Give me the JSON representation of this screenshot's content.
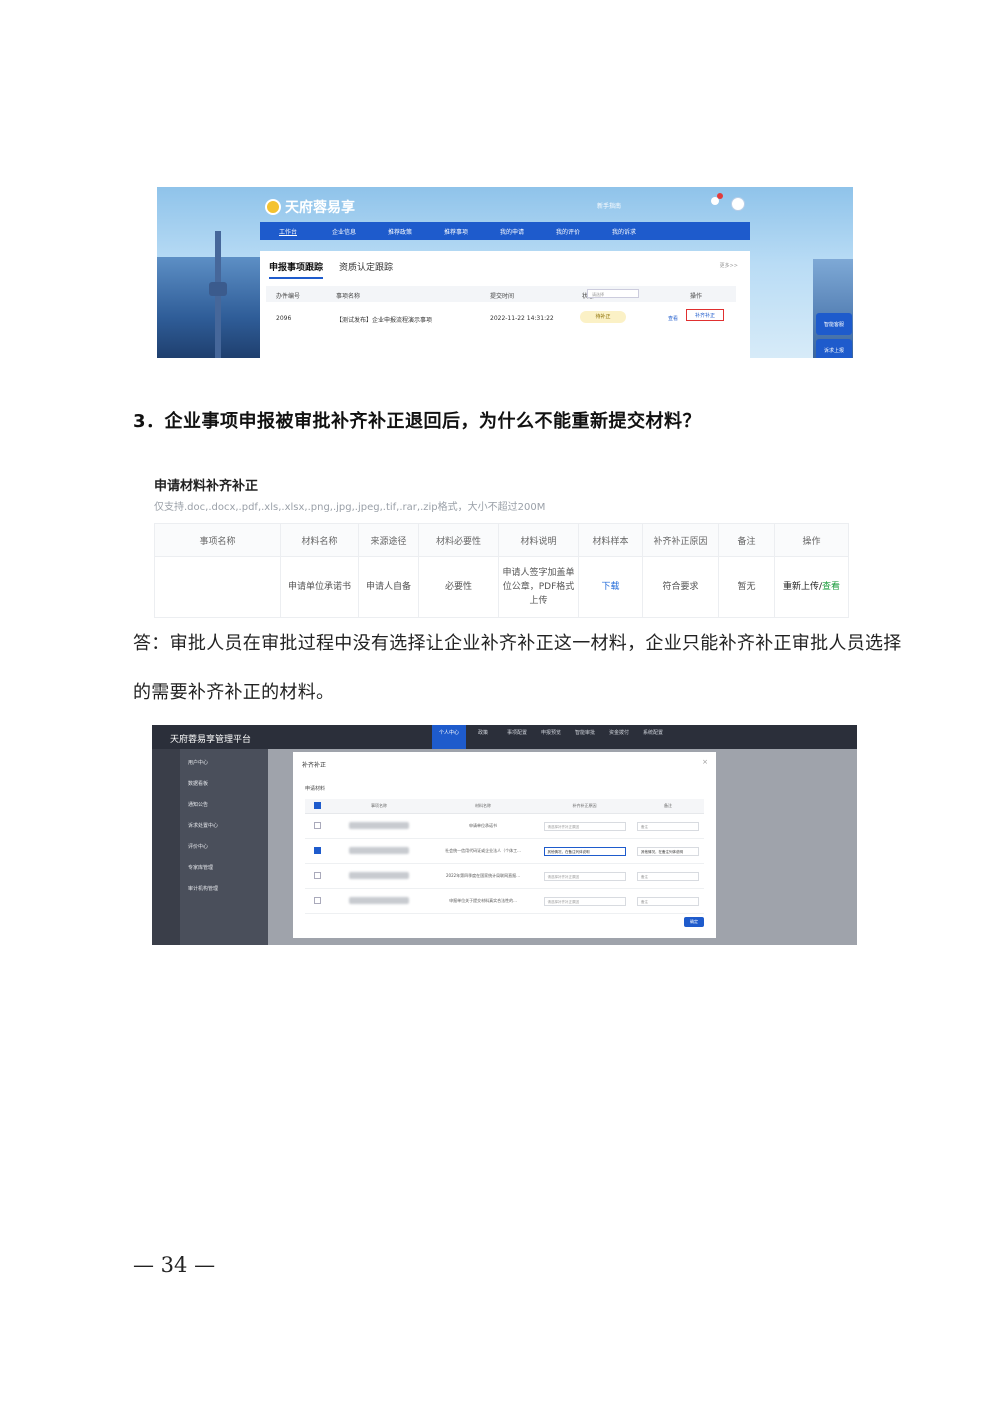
{
  "shot1": {
    "logo_text": "天府蓉易享",
    "header_link": "新手指南",
    "nav": [
      "工作台",
      "企业信息",
      "推荐政策",
      "推荐事项",
      "我的申请",
      "我的评价",
      "我的诉求"
    ],
    "tabs": [
      "申报事项跟踪",
      "资质认定跟踪"
    ],
    "more": "更多>>",
    "columns": [
      "办件编号",
      "事项名称",
      "提交时间",
      "状态",
      "操作"
    ],
    "status_placeholder": "请选择",
    "row": {
      "id": "2096",
      "name": "【测试发布】企业申报流程演示事项",
      "time": "2022-11-22 14:31:22",
      "status": "待补正",
      "view": "查看",
      "action": "补齐补正"
    },
    "side_buttons": [
      "智能客服",
      "诉求上报"
    ]
  },
  "question": "3．企业事项申报被审批补齐补正退回后，为什么不能重新提交材料？",
  "shot2": {
    "title": "申请材料补齐补正",
    "hint": "仅支持.doc,.docx,.pdf,.xls,.xlsx,.png,.jpg,.jpeg,.tif,.rar,.zip格式，大小不超过200M",
    "columns": [
      "事项名称",
      "材料名称",
      "来源途径",
      "材料必要性",
      "材料说明",
      "材料样本",
      "补齐补正原因",
      "备注",
      "操作"
    ],
    "row": {
      "item": "",
      "material": "申请单位承诺书",
      "source": "申请人自备",
      "necessity": "必要性",
      "description": "申请人签字加盖单位公章，PDF格式上传",
      "sample": "下载",
      "reason": "符合要求",
      "remark": "暂无",
      "reupload": "重新上传/",
      "view": "查看"
    }
  },
  "answer_line1": "答：审批人员在审批过程中没有选择让企业补齐补正这一材料，企业只能补齐补正审批人员选择",
  "answer_line2": "的需要补齐补正的材料。",
  "shot3": {
    "title": "天府蓉易享管理平台",
    "topnav": [
      "个人中心",
      "政策",
      "事项配置",
      "申报预览",
      "智能审批",
      "资金拨付",
      "系统配置"
    ],
    "sidebar": [
      "用户中心",
      "数据看板",
      "通知公告",
      "诉求处置中心",
      "评价中心",
      "专家库管理",
      "审计机构管理"
    ],
    "modal_title": "补齐补正",
    "modal_sub": "申请材料",
    "columns": [
      "事项名称",
      "材料名称",
      "补齐补正原因",
      "备注"
    ],
    "rows": [
      {
        "checked": false,
        "material": "申请单位承诺书",
        "reason": "请选择补齐补正原因",
        "remark": "备注"
      },
      {
        "checked": true,
        "material": "社会统一信用代码证或企业法人（个体工...",
        "reason": "其他情况，在备注列体说明",
        "remark": "其他情况，在备注列体说明"
      },
      {
        "checked": false,
        "material": "2022年第四季度在国家统计局联网直报...",
        "reason": "请选择补齐补正原因",
        "remark": "备注"
      },
      {
        "checked": false,
        "material": "申报单位关于提交材料真实合法性的...",
        "reason": "请选择补齐补正原因",
        "remark": "备注"
      }
    ],
    "ok": "确定"
  },
  "page_number": "— 34 —"
}
